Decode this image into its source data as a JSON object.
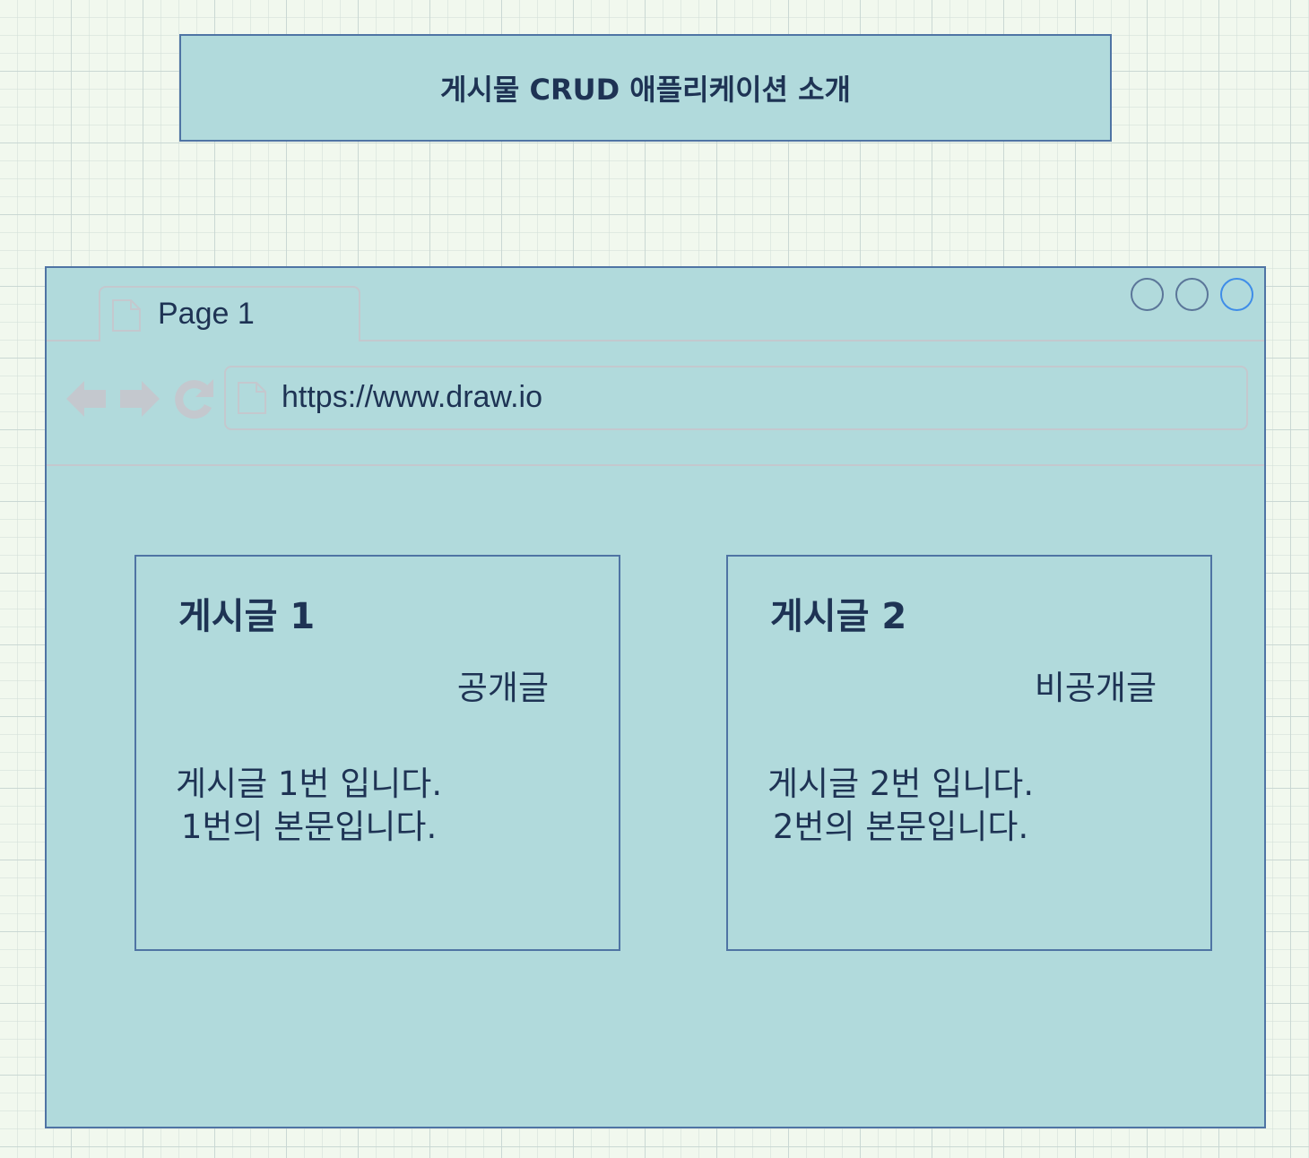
{
  "title": "게시물 CRUD 애플리케이션 소개",
  "browser": {
    "tab_label": "Page 1",
    "url": "https://www.draw.io",
    "icons": {
      "tab": "page-icon",
      "back": "arrow-left-icon",
      "forward": "arrow-right-icon",
      "reload": "reload-icon",
      "url": "page-icon"
    }
  },
  "posts": [
    {
      "title": "게시글 1",
      "visibility": "공개글",
      "body": "게시글 1번 입니다.\n1번의 본문입니다."
    },
    {
      "title": "게시글 2",
      "visibility": "비공개글",
      "body": "게시글 2번 입니다.\n2번의 본문입니다."
    }
  ],
  "colors": {
    "fill": "#b1dadc",
    "stroke": "#4f74a4",
    "text": "#1e3354",
    "chrome_gray": "#c4c8ce",
    "active_circle": "#3f8de8",
    "background": "#f1f8ee"
  }
}
